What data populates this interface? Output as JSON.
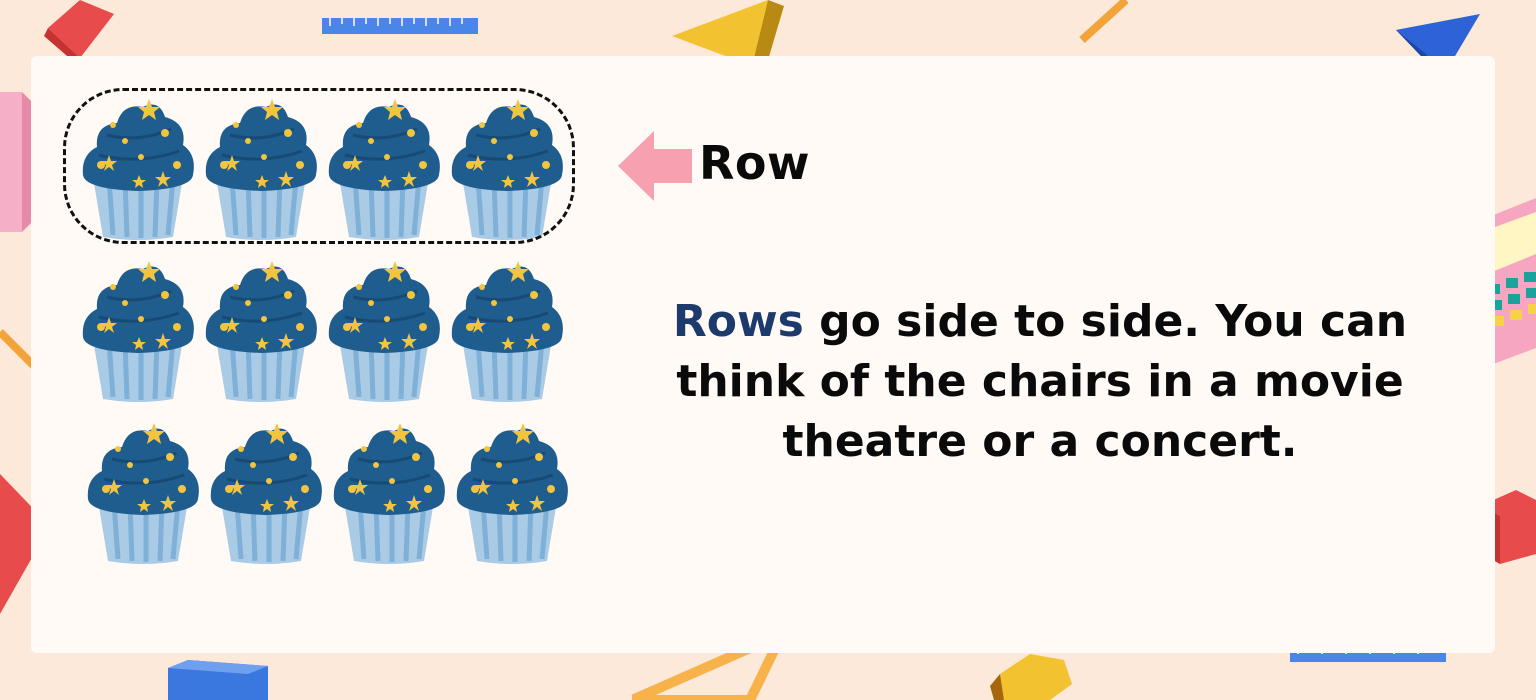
{
  "label": {
    "row": "Row"
  },
  "description": {
    "highlight": "Rows",
    "rest": " go side to side. You can think of the chairs in a movie theatre or a concert."
  },
  "grid": {
    "rows": 3,
    "cols": 4
  },
  "colors": {
    "background": "#fde9da",
    "card": "#fffaf6",
    "highlight": "#1c3a6b",
    "arrow": "#f7a0b0",
    "frosting": "#1f5d8e",
    "wrapper": "#a9cbe6"
  },
  "icons": [
    "cupcake-icon",
    "left-arrow-icon",
    "ruler-icon",
    "pencil-icon",
    "triangle-icon",
    "cube-icon",
    "calculator-icon"
  ]
}
